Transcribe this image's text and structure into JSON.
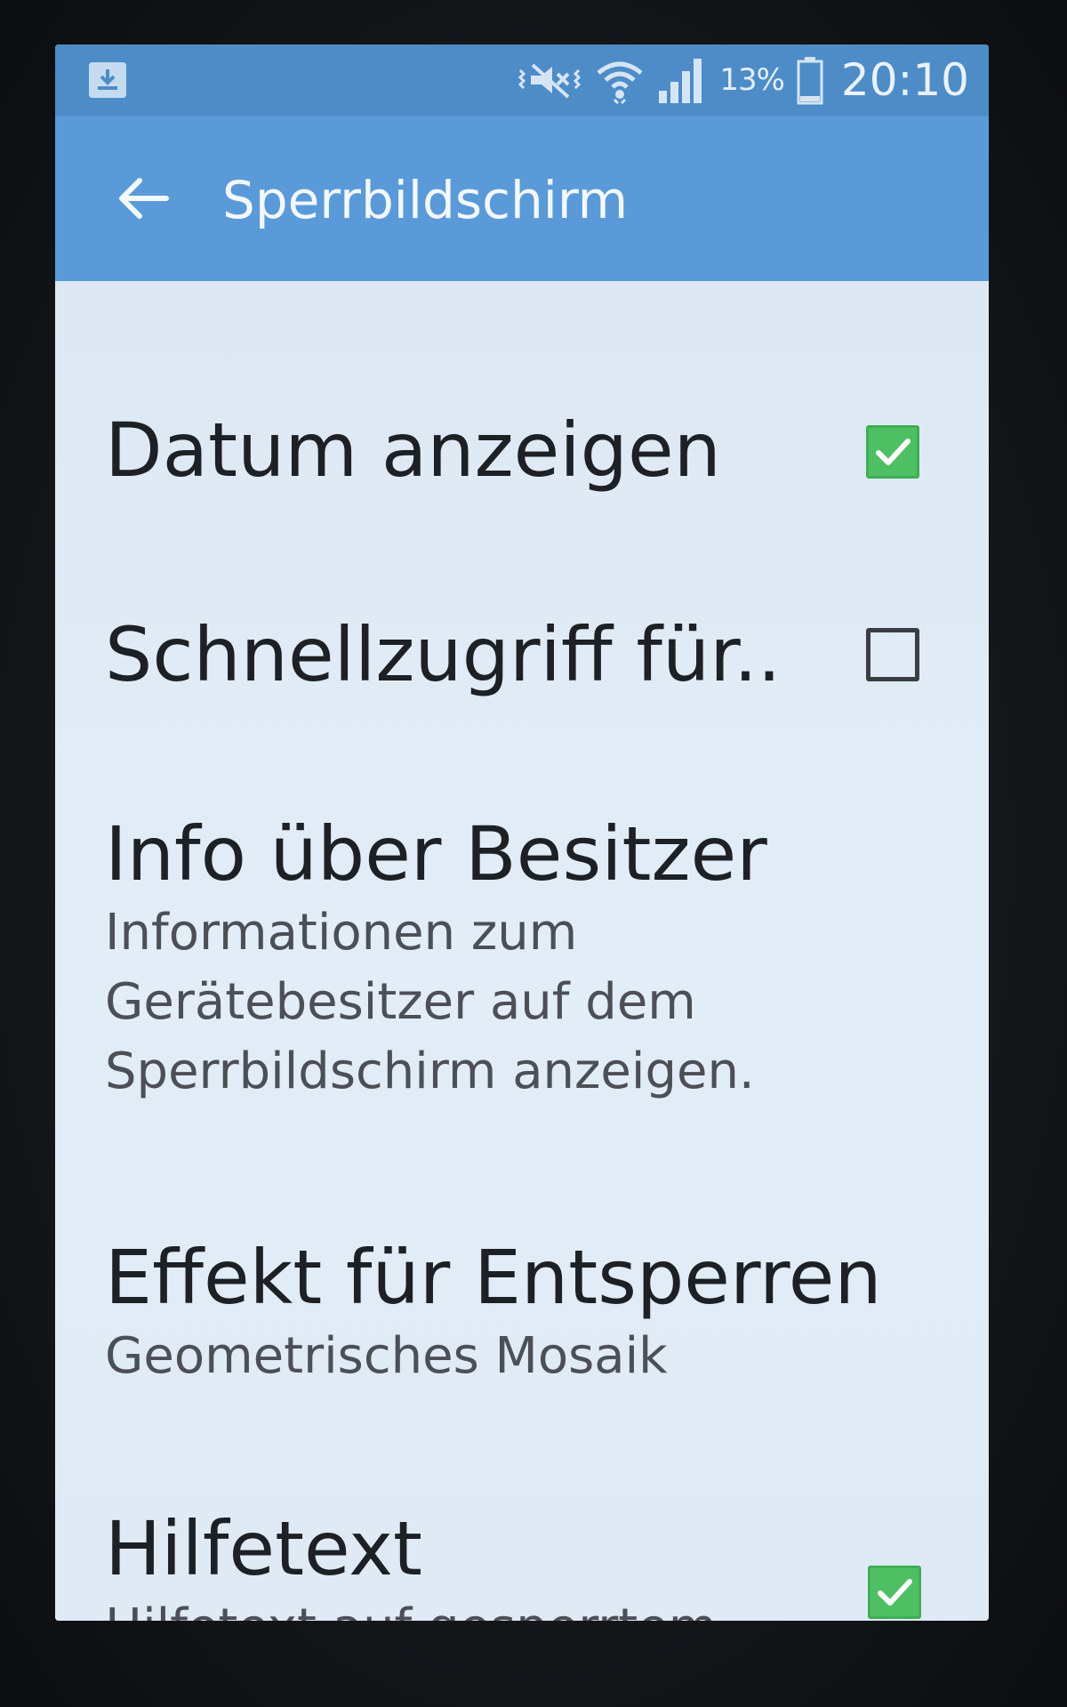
{
  "status_bar": {
    "left_icon": "download-icon",
    "icons": [
      "vibrate-icon",
      "wifi-icon",
      "signal-icon"
    ],
    "battery_percent": "13%",
    "battery_icon": "battery-icon",
    "time": "20:10"
  },
  "app_bar": {
    "back_icon": "arrow-back-icon",
    "title": "Sperrbildschirm",
    "color": "#5a9ad8"
  },
  "settings": [
    {
      "title": "Datum anzeigen",
      "checkbox": "checked"
    },
    {
      "title": "Schnellzugriff für..",
      "checkbox": "unchecked"
    },
    {
      "title": "Info über Besitzer",
      "subtitle_lines": [
        "Informationen zum",
        "Gerätebesitzer auf dem",
        "Sperrbildschirm anzeigen."
      ]
    },
    {
      "title": "Effekt für Entsperren",
      "subtitle": "Geometrisches Mosaik"
    },
    {
      "title": "Hilfetext",
      "subtitle": "Hilfetext auf gesperrtem",
      "checkbox": "checked"
    }
  ],
  "colors": {
    "status_bar": "#4e8cc8",
    "checkbox_checked": "#4fbf63",
    "background": "#dde8f3"
  }
}
